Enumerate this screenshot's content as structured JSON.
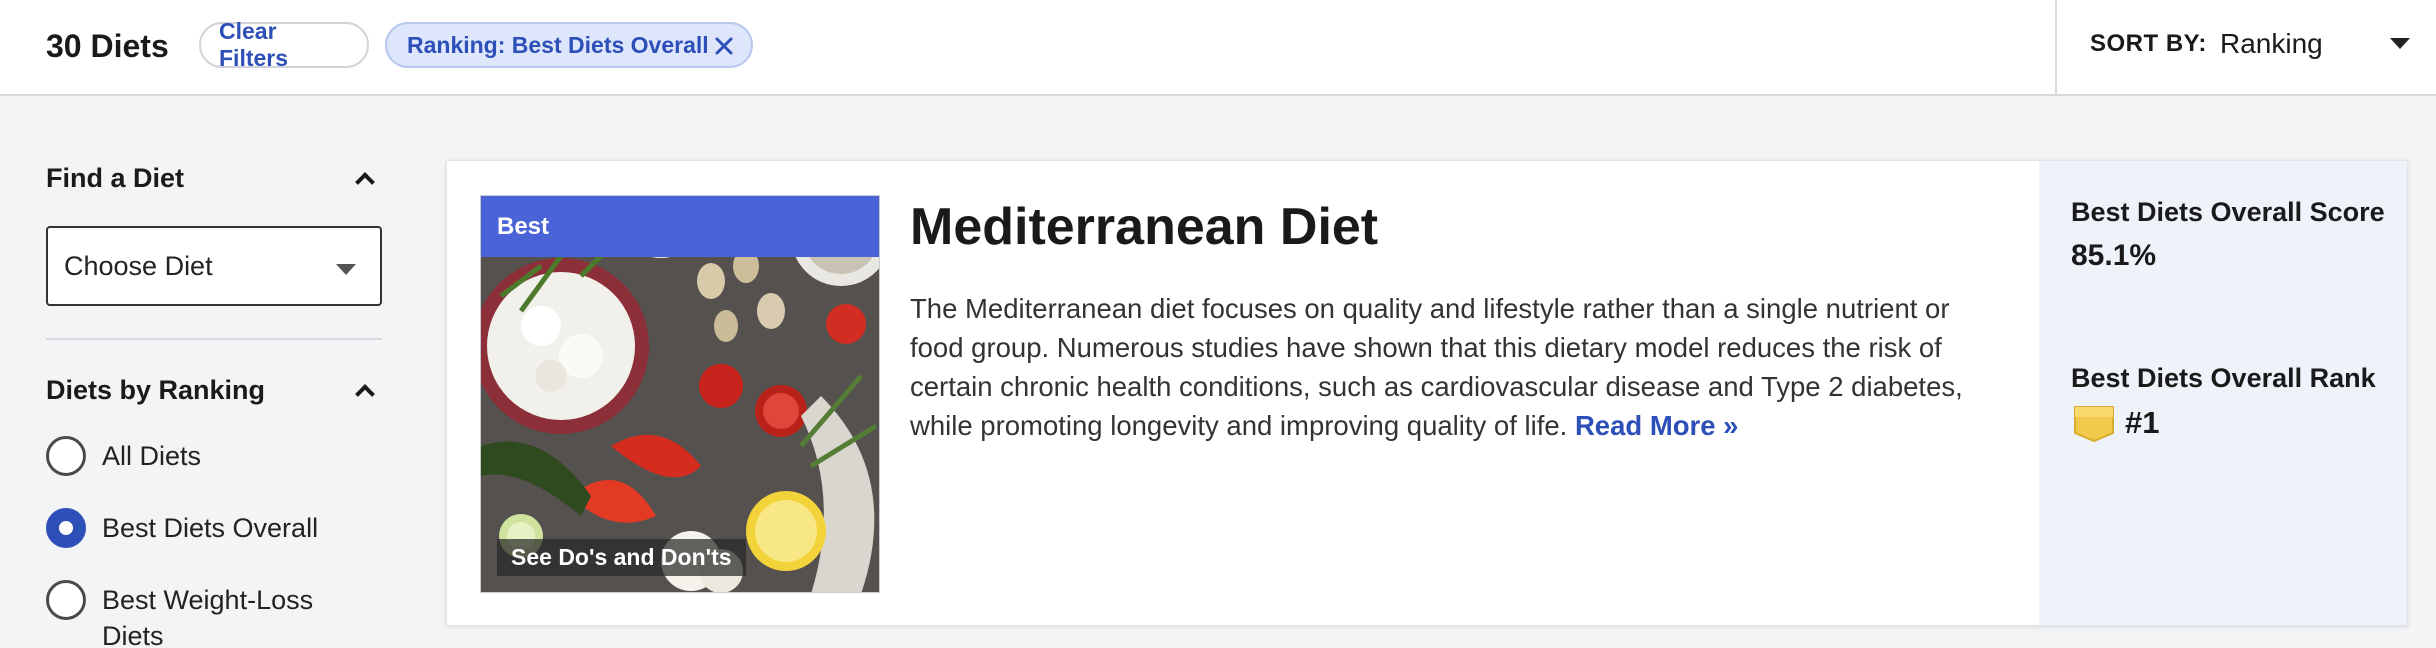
{
  "header": {
    "count": "30 Diets",
    "clear_filters": "Clear Filters",
    "active_filter": "Ranking: Best Diets Overall",
    "sort_label": "SORT BY:",
    "sort_value": "Ranking"
  },
  "sidebar": {
    "find_title": "Find a Diet",
    "select_placeholder": "Choose Diet",
    "ranking_title": "Diets by Ranking",
    "options": [
      {
        "label": "All Diets",
        "checked": false
      },
      {
        "label": "Best Diets Overall",
        "checked": true
      },
      {
        "label": "Best Weight-Loss Diets",
        "checked": false
      }
    ]
  },
  "diet": {
    "badge": "Best",
    "image_caption": "See Do's and Don'ts",
    "title": "Mediterranean Diet",
    "description": "The Mediterranean diet focuses on quality and lifestyle rather than a single nutrient or food group. Numerous studies have shown that this dietary model reduces the risk of certain chronic health conditions, such as cardiovascular disease and Type 2 diabetes, while promoting longevity and improving quality of life.",
    "read_more": "Read More »",
    "score_label": "Best Diets Overall Score",
    "score_value": "85.1%",
    "rank_label": "Best Diets Overall Rank",
    "rank_value": "#1"
  },
  "colors": {
    "accent": "#2d4fb8",
    "badge": "#4a63d6",
    "filter_chip_bg": "#dde6fb",
    "score_panel_bg": "#eef3fa",
    "rank_icon": "#f2c94c"
  },
  "icons": {
    "filter_close": "close-icon",
    "sort_caret": "chevron-down-icon",
    "section_toggle": "chevron-up-icon",
    "rank": "award-ribbon-icon"
  }
}
